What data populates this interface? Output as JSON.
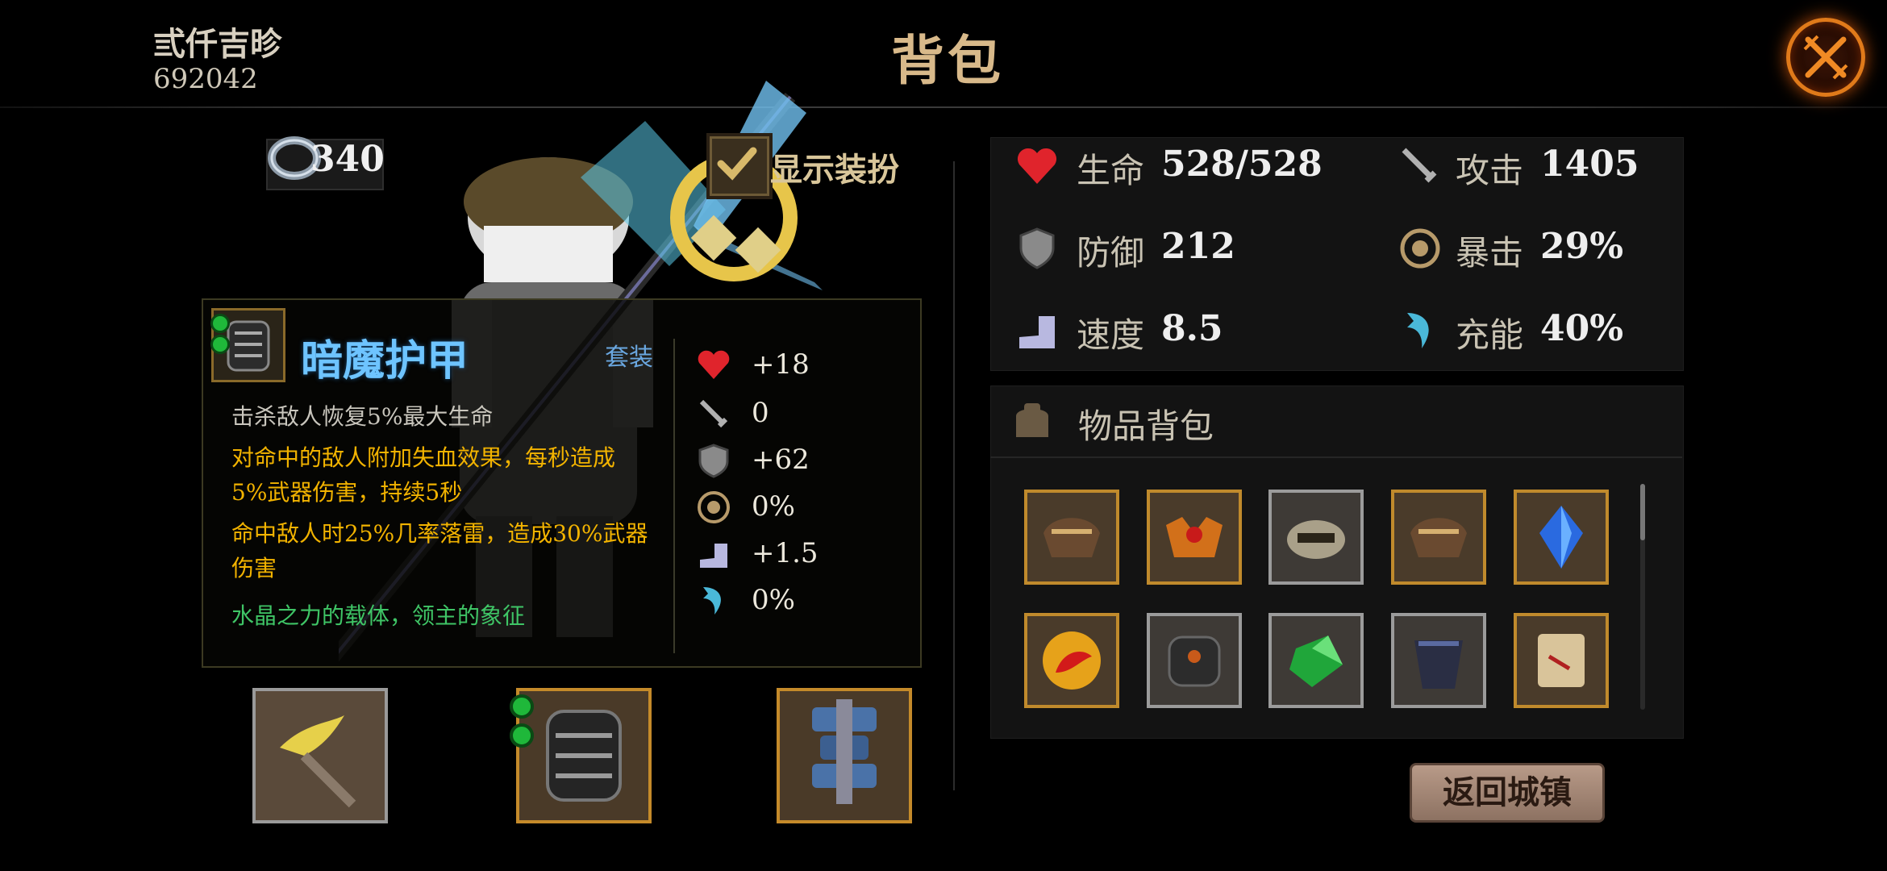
{
  "header": {
    "player_name": "弎仟吉昣",
    "player_id": "692042",
    "title": "背包",
    "close_icon": "close-swords-icon"
  },
  "currency": {
    "icon": "ring-icon",
    "value": "340"
  },
  "show_outfit": {
    "label": "显示装扮",
    "checked": true
  },
  "tooltip": {
    "item_name": "暗魔护甲",
    "set_label": "套装",
    "lines": [
      "击杀敌人恢复5%最大生命",
      "对命中的敌人附加失血效果，每秒造成5%武器伤害，持续5秒",
      "命中敌人时25%几率落雷，造成30%武器伤害",
      "水晶之力的载体，领主的象征"
    ],
    "stats": [
      {
        "icon": "heart-icon",
        "value": "+18"
      },
      {
        "icon": "sword-icon",
        "value": "0"
      },
      {
        "icon": "shield-icon",
        "value": "+62"
      },
      {
        "icon": "crit-icon",
        "value": "0%"
      },
      {
        "icon": "speed-icon",
        "value": "+1.5"
      },
      {
        "icon": "energy-icon",
        "value": "0%"
      }
    ]
  },
  "equipped": [
    {
      "slot": "weapon",
      "icon": "claw-weapon-icon"
    },
    {
      "slot": "armor",
      "icon": "dark-armor-icon"
    },
    {
      "slot": "boots",
      "icon": "blue-greaves-icon"
    }
  ],
  "stats": {
    "hp_label": "生命",
    "hp_value": "528/528",
    "atk_label": "攻击",
    "atk_value": "1405",
    "def_label": "防御",
    "def_value": "212",
    "crit_label": "暴击",
    "crit_value": "29%",
    "spd_label": "速度",
    "spd_value": "8.5",
    "charge_label": "充能",
    "charge_value": "40%"
  },
  "inventory": {
    "title": "物品背包",
    "items": [
      {
        "icon": "shoulder-pads-icon",
        "rarity": "gold"
      },
      {
        "icon": "ruby-crown-icon",
        "rarity": "gold"
      },
      {
        "icon": "silver-helm-icon",
        "rarity": "silver"
      },
      {
        "icon": "shoulder-pads-icon",
        "rarity": "gold"
      },
      {
        "icon": "blue-crystal-icon",
        "rarity": "gold"
      },
      {
        "icon": "fire-orb-icon",
        "rarity": "gold"
      },
      {
        "icon": "dark-chestplate-icon",
        "rarity": "silver"
      },
      {
        "icon": "green-gem-icon",
        "rarity": "silver"
      },
      {
        "icon": "dark-cloak-icon",
        "rarity": "silver"
      },
      {
        "icon": "scroll-icon",
        "rarity": "gold"
      }
    ]
  },
  "return_button": {
    "label": "返回城镇"
  },
  "colors": {
    "title_gold": "#d8b98a",
    "item_name_blue": "#6ec4ff",
    "effect_yellow": "#f2b300",
    "lore_green": "#3fc566",
    "close_orange": "#e07a1a"
  }
}
